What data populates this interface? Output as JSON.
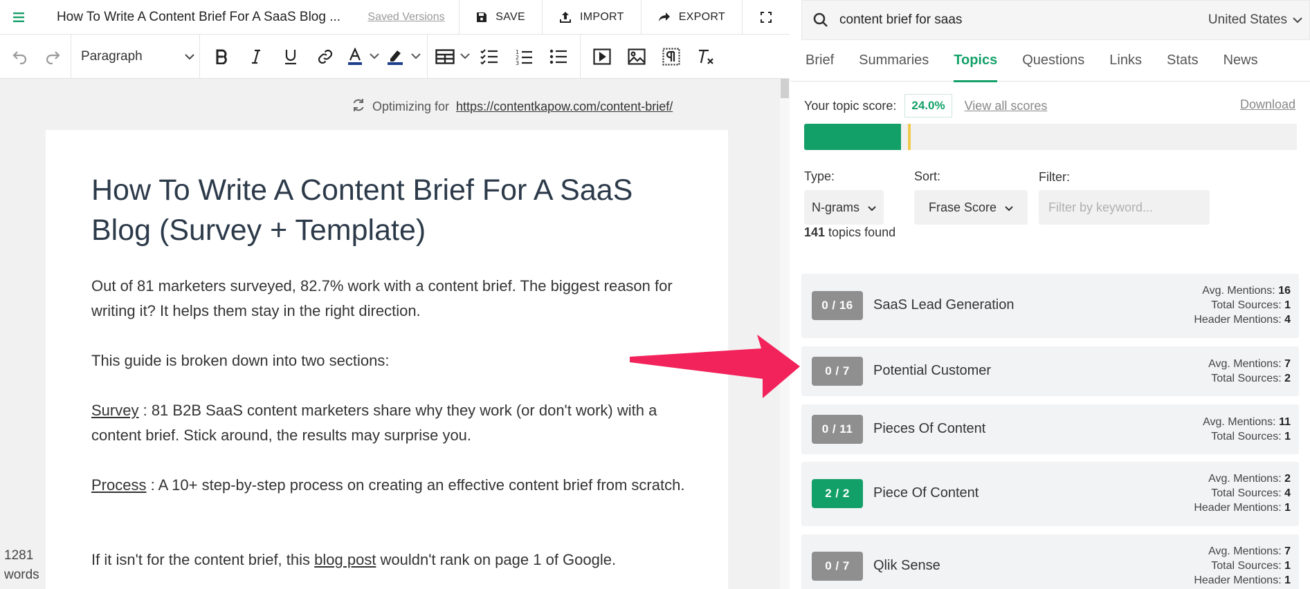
{
  "header": {
    "doc_title": "How To Write A Content Brief For A SaaS Blog ...",
    "saved_versions": "Saved Versions",
    "save": "SAVE",
    "import": "IMPORT",
    "export": "EXPORT"
  },
  "toolbar": {
    "block_style": "Paragraph"
  },
  "editor": {
    "optimizing_label": "Optimizing for",
    "optimizing_url": "https://contentkapow.com/content-brief/",
    "title": "How To Write A Content Brief For A SaaS Blog (Survey + Template)",
    "p1": "Out of 81 marketers surveyed, 82.7% work with a content brief. The biggest reason for writing it? It helps them stay in the right direction.",
    "p2": "This guide is broken down into two sections:",
    "p3_link": "Survey",
    "p3_rest": " : 81 B2B SaaS content marketers share why they work (or don't work) with a content brief. Stick around, the results may surprise you.",
    "p4_link": "Process",
    "p4_rest": " : A 10+ step-by-step process on creating an effective content brief from scratch.",
    "p5_a": "If it isn't for the content brief, this ",
    "p5_link": "blog post",
    "p5_b": " wouldn't rank on page 1 of Google.",
    "word_count": "1281",
    "words_label": "words"
  },
  "search": {
    "query": "content brief for saas",
    "country": "United States"
  },
  "tabs": [
    "Brief",
    "Summaries",
    "Topics",
    "Questions",
    "Links",
    "Stats",
    "News"
  ],
  "active_tab": "Topics",
  "score": {
    "label": "Your topic score:",
    "value": "24.0%",
    "view_all": "View all scores",
    "download": "Download",
    "fill_fraction": 0.24,
    "target_fraction": 0.26
  },
  "filters": {
    "type_label": "Type:",
    "type_value": "N-grams",
    "sort_label": "Sort:",
    "sort_value": "Frase Score",
    "filter_label": "Filter:",
    "filter_placeholder": "Filter by keyword...",
    "found_count": "141",
    "found_label": " topics found"
  },
  "stat_labels": {
    "avg": "Avg. Mentions:",
    "sources": "Total Sources:",
    "header": "Header Mentions:"
  },
  "topics": [
    {
      "badge": "0 / 16",
      "name": "SaaS Lead Generation",
      "avg": "16",
      "sources": "1",
      "header": "4",
      "done": false
    },
    {
      "badge": "0 / 7",
      "name": "Potential Customer",
      "avg": "7",
      "sources": "2",
      "header": null,
      "done": false
    },
    {
      "badge": "0 / 11",
      "name": "Pieces Of Content",
      "avg": "11",
      "sources": "1",
      "header": null,
      "done": false
    },
    {
      "badge": "2 / 2",
      "name": "Piece Of Content",
      "avg": "2",
      "sources": "4",
      "header": "1",
      "done": true
    },
    {
      "badge": "0 / 7",
      "name": "Qlik Sense",
      "avg": "7",
      "sources": "1",
      "header": "1",
      "done": false
    }
  ],
  "colors": {
    "accent": "#13a068",
    "badge_gray": "#8f8f8f",
    "target_marker": "#f2c94c",
    "annotation_arrow": "#f2225a"
  }
}
